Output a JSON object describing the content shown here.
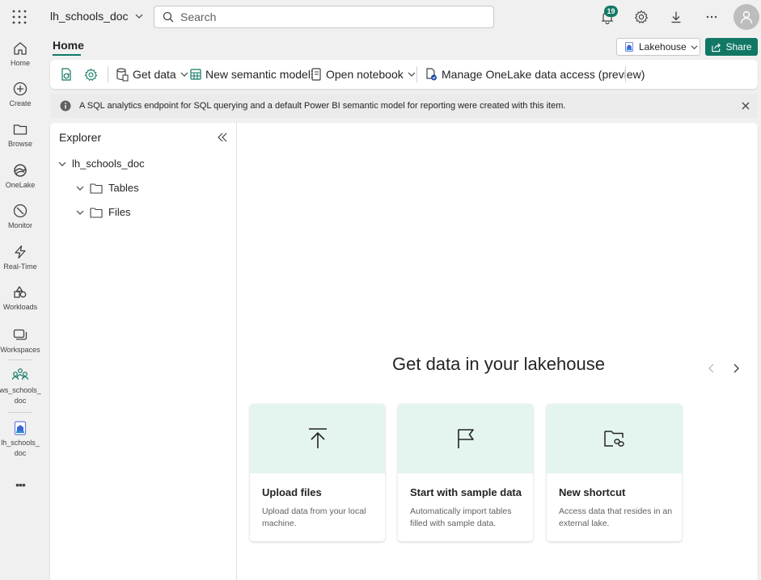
{
  "topbar": {
    "app_name": "lh_schools_doc",
    "search_placeholder": "Search",
    "notification_count": "19"
  },
  "nav": {
    "items": [
      {
        "label": "Home",
        "icon": "home-icon"
      },
      {
        "label": "Create",
        "icon": "plus-circle-icon"
      },
      {
        "label": "Browse",
        "icon": "folder-icon"
      },
      {
        "label": "OneLake",
        "icon": "onelake-icon"
      },
      {
        "label": "Monitor",
        "icon": "monitor-icon"
      },
      {
        "label": "Real-Time",
        "icon": "lightning-icon"
      },
      {
        "label": "Workloads",
        "icon": "workloads-icon"
      },
      {
        "label": "Workspaces",
        "icon": "workspaces-icon"
      },
      {
        "label": "ws_schools_ doc",
        "icon": "workspace-people-icon"
      },
      {
        "label": "lh_schools_ doc",
        "icon": "lakehouse-icon"
      }
    ],
    "more_label": "•••"
  },
  "header": {
    "tab": "Home",
    "lakehouse_label": "Lakehouse",
    "share_label": "Share"
  },
  "toolbar": {
    "get_data": "Get data",
    "new_semantic_model": "New semantic model",
    "open_notebook": "Open notebook",
    "manage_onelake": "Manage OneLake data access (preview)"
  },
  "info": {
    "message": "A SQL analytics endpoint for SQL querying and a default Power BI semantic model for reporting were created with this item."
  },
  "explorer": {
    "title": "Explorer",
    "root": "lh_schools_doc",
    "children": [
      "Tables",
      "Files"
    ]
  },
  "main": {
    "hero_title": "Get data in your lakehouse",
    "cards": [
      {
        "title": "Upload files",
        "desc": "Upload data from your local machine."
      },
      {
        "title": "Start with sample data",
        "desc": "Automatically import tables filled with sample data."
      },
      {
        "title": "New shortcut",
        "desc": "Access data that resides in an external lake."
      }
    ]
  },
  "colors": {
    "accent": "#117865",
    "card_header": "#e3f5ee",
    "background": "#f0f0f0"
  }
}
